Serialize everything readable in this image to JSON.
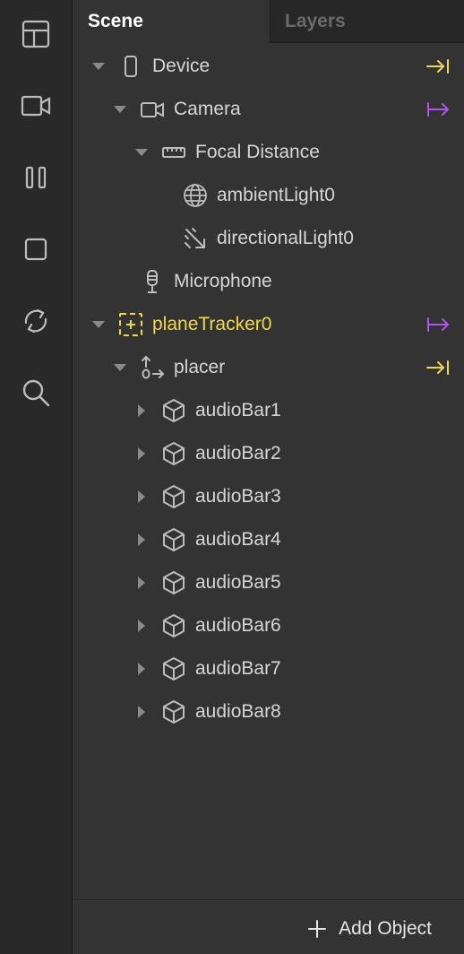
{
  "toolbar": {
    "items": [
      {
        "icon": "layout-icon"
      },
      {
        "icon": "video-camera-icon"
      },
      {
        "icon": "pause-icon"
      },
      {
        "icon": "stop-icon"
      },
      {
        "icon": "refresh-icon"
      },
      {
        "icon": "search-icon"
      }
    ]
  },
  "tabs": {
    "scene": "Scene",
    "layers": "Layers"
  },
  "tree": {
    "device": "Device",
    "camera": "Camera",
    "focal_distance": "Focal Distance",
    "ambient_light": "ambientLight0",
    "directional_light": "directionalLight0",
    "microphone": "Microphone",
    "plane_tracker": "planeTracker0",
    "placer": "placer",
    "audio_bars": [
      "audioBar1",
      "audioBar2",
      "audioBar3",
      "audioBar4",
      "audioBar5",
      "audioBar6",
      "audioBar7",
      "audioBar8"
    ]
  },
  "footer": {
    "add_object": "Add Object"
  },
  "colors": {
    "accent_yellow": "#f2d845",
    "accent_purple": "#b452f0",
    "text": "#d6d6d6",
    "icon": "#bdbdbd"
  }
}
